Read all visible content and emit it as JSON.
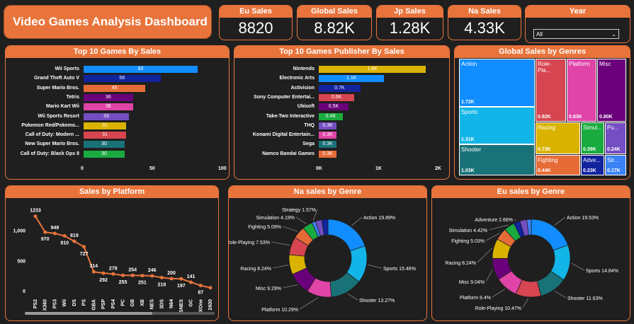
{
  "dashboard": {
    "title": "Video Games Analysis Dashboard"
  },
  "kpis": [
    {
      "label": "Eu Sales",
      "value": "8820"
    },
    {
      "label": "Global Sales",
      "value": "8.82K"
    },
    {
      "label": "Jp Sales",
      "value": "1.28K"
    },
    {
      "label": "Na Sales",
      "value": "4.33K"
    }
  ],
  "year_filter": {
    "label": "Year",
    "selected": "All"
  },
  "top_games": {
    "title": "Top 10 Games By Sales",
    "items": [
      {
        "name": "Wii Sports",
        "value": 83,
        "label": "83",
        "color": "#118dff"
      },
      {
        "name": "Grand Theft Auto V",
        "value": 56,
        "label": "56",
        "color": "#12239e"
      },
      {
        "name": "Super Mario Bros.",
        "value": 45,
        "label": "45",
        "color": "#e66c37"
      },
      {
        "name": "Tetris",
        "value": 36,
        "label": "36",
        "color": "#6b007b"
      },
      {
        "name": "Mario Kart Wii",
        "value": 36,
        "label": "36",
        "color": "#e044a7"
      },
      {
        "name": "Wii Sports Resort",
        "value": 33,
        "label": "33",
        "color": "#744ec2"
      },
      {
        "name": "Pokemon Red/Pokemo...",
        "value": 31,
        "label": "31",
        "color": "#d9b300"
      },
      {
        "name": "Call of Duty: Modern ...",
        "value": 31,
        "label": "31",
        "color": "#d64550"
      },
      {
        "name": "New Super Mario Bros.",
        "value": 30,
        "label": "30",
        "color": "#197278"
      },
      {
        "name": "Call of Duty: Black Ops II",
        "value": 30,
        "label": "30",
        "color": "#1aab40"
      }
    ],
    "axis_ticks": [
      "0",
      "50",
      "100"
    ],
    "max": 100
  },
  "top_publishers": {
    "title": "Top 10 Games Publisher By Sales",
    "items": [
      {
        "name": "Nintendo",
        "value": 1.8,
        "label": "1.8K",
        "color": "#d9b300"
      },
      {
        "name": "Electronic Arts",
        "value": 1.1,
        "label": "1.1K",
        "color": "#118dff"
      },
      {
        "name": "Activision",
        "value": 0.7,
        "label": "0.7K",
        "color": "#12239e"
      },
      {
        "name": "Sony Computer Entertai...",
        "value": 0.6,
        "label": "0.6K",
        "color": "#d64550"
      },
      {
        "name": "Ubisoft",
        "value": 0.5,
        "label": "0.5K",
        "color": "#6b007b"
      },
      {
        "name": "Take-Two Interactive",
        "value": 0.4,
        "label": "0.4K",
        "color": "#1aab40"
      },
      {
        "name": "THQ",
        "value": 0.3,
        "label": "0.3K",
        "color": "#744ec2"
      },
      {
        "name": "Konami Digital Entertain...",
        "value": 0.3,
        "label": "0.3K",
        "color": "#e044a7"
      },
      {
        "name": "Sega",
        "value": 0.3,
        "label": "0.3K",
        "color": "#197278"
      },
      {
        "name": "Namco Bandai Games",
        "value": 0.3,
        "label": "0.3K",
        "color": "#e66c37"
      }
    ],
    "axis_ticks": [
      "0K",
      "1K",
      "2K"
    ],
    "max": 2
  },
  "genres_treemap": {
    "title": "Global Sales by Genres",
    "cells": [
      {
        "name": "Action",
        "value": "1.72K",
        "color": "#118dff"
      },
      {
        "name": "Sports",
        "value": "1.31K",
        "color": "#12b5e8"
      },
      {
        "name": "Shooter",
        "value": "1.03K",
        "color": "#197278"
      },
      {
        "name": "Role-Pla...",
        "value": "0.92K",
        "color": "#d64550"
      },
      {
        "name": "Platform",
        "value": "0.83K",
        "color": "#e044a7"
      },
      {
        "name": "Misc",
        "value": "0.80K",
        "color": "#6b007b"
      },
      {
        "name": "Racing",
        "value": "0.73K",
        "color": "#d9b300"
      },
      {
        "name": "Simul...",
        "value": "0.39K",
        "color": "#1aab40"
      },
      {
        "name": "Pu...",
        "value": "0.24K",
        "color": "#744ec2"
      },
      {
        "name": "Fighting",
        "value": "0.44K",
        "color": "#e66c37"
      },
      {
        "name": "Adve...",
        "value": "0.23K",
        "color": "#12239e"
      },
      {
        "name": "Str...",
        "value": "0.17K",
        "color": "#3b82f6"
      }
    ]
  },
  "platform_chart": {
    "title": "Sales by Platform",
    "ytick_labels": [
      "0",
      "500",
      "1,000"
    ],
    "chart_data": {
      "type": "line",
      "ylim": [
        0,
        1300
      ],
      "categories": [
        "PS2",
        "X360",
        "PS3",
        "Wii",
        "DS",
        "PS",
        "GBA",
        "PSP",
        "PS4",
        "PC",
        "GB",
        "XB",
        "NES",
        "3DS",
        "N64",
        "SNES",
        "GC",
        "XOne",
        "2600"
      ],
      "values": [
        1233,
        970,
        949,
        909,
        819,
        727,
        314,
        292,
        278,
        255,
        254,
        251,
        246,
        218,
        200,
        197,
        141,
        87,
        50
      ],
      "labels": [
        "1233",
        "970",
        "949",
        "910",
        "819",
        "727",
        "314",
        "292",
        "278",
        "255",
        "254",
        "251",
        "246",
        "218",
        "200",
        "197",
        "141",
        "87",
        ""
      ]
    }
  },
  "na_genre": {
    "title": "Na sales by Genre",
    "chart_data": {
      "type": "pie",
      "slices": [
        {
          "label": "Action 19.89%",
          "value": 19.89,
          "color": "#118dff"
        },
        {
          "label": "Sports 15.46%",
          "value": 15.46,
          "color": "#12b5e8"
        },
        {
          "label": "Shooter 13.27%",
          "value": 13.27,
          "color": "#197278"
        },
        {
          "label": "Platform 10.29%",
          "value": 10.29,
          "color": "#e044a7"
        },
        {
          "label": "Misc 9.29%",
          "value": 9.29,
          "color": "#6b007b"
        },
        {
          "label": "Racing 8.24%",
          "value": 8.24,
          "color": "#d9b300"
        },
        {
          "label": "Role-Playing 7.53%",
          "value": 7.53,
          "color": "#d64550"
        },
        {
          "label": "Fighting 5.09%",
          "value": 5.09,
          "color": "#e66c37"
        },
        {
          "label": "Simulation 4.19%",
          "value": 4.19,
          "color": "#1aab40"
        },
        {
          "label": "Strategy 1.57%",
          "value": 1.57,
          "color": "#3b82f6"
        },
        {
          "label": "",
          "value": 2.6,
          "color": "#744ec2"
        },
        {
          "label": "",
          "value": 2.58,
          "color": "#12239e"
        }
      ]
    }
  },
  "eu_genre": {
    "title": "Eu sales by Genre",
    "chart_data": {
      "type": "pie",
      "slices": [
        {
          "label": "Action 19.53%",
          "value": 19.53,
          "color": "#118dff"
        },
        {
          "label": "Sports 14.84%",
          "value": 14.84,
          "color": "#12b5e8"
        },
        {
          "label": "Shooter 11.63%",
          "value": 11.63,
          "color": "#197278"
        },
        {
          "label": "Role-Playing 10.47%",
          "value": 10.47,
          "color": "#d64550"
        },
        {
          "label": "Platform 9.4%",
          "value": 9.4,
          "color": "#e044a7"
        },
        {
          "label": "Misc 9.04%",
          "value": 9.04,
          "color": "#6b007b"
        },
        {
          "label": "Racing 8.24%",
          "value": 8.24,
          "color": "#d9b300"
        },
        {
          "label": "Fighting 5.03%",
          "value": 5.03,
          "color": "#e66c37"
        },
        {
          "label": "Simulation 4.42%",
          "value": 4.42,
          "color": "#1aab40"
        },
        {
          "label": "Adventure 2.66%",
          "value": 2.66,
          "color": "#12239e"
        },
        {
          "label": "",
          "value": 2.9,
          "color": "#744ec2"
        },
        {
          "label": "",
          "value": 1.84,
          "color": "#3b82f6"
        }
      ]
    }
  }
}
